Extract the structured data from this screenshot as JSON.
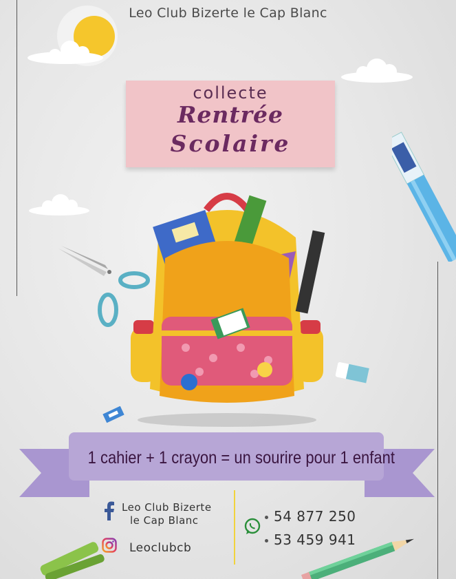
{
  "header": {
    "org_name": "Leo Club Bizerte le Cap Blanc"
  },
  "title_card": {
    "line1": "collecte",
    "line2": "Rentrée",
    "line3": "Scolaire"
  },
  "ribbon": {
    "slogan": "1 cahier + 1 crayon = un sourire pour 1 enfant"
  },
  "contacts": {
    "facebook_line1": "Leo  Club Bizerte",
    "facebook_line2": "le Cap Blanc",
    "instagram": "Leoclubcb",
    "phones": [
      "54 877 250",
      "53 459 941"
    ]
  },
  "icons": {
    "facebook": "facebook-icon",
    "instagram": "instagram-icon",
    "whatsapp": "whatsapp-icon"
  },
  "colors": {
    "title_card_bg": "#f1c4c8",
    "title_text": "#6b2a60",
    "ribbon": "#b7a6d6",
    "backpack_orange": "#f0a21a",
    "backpack_pocket": "#e05a7a",
    "sun": "#f5c62c"
  }
}
